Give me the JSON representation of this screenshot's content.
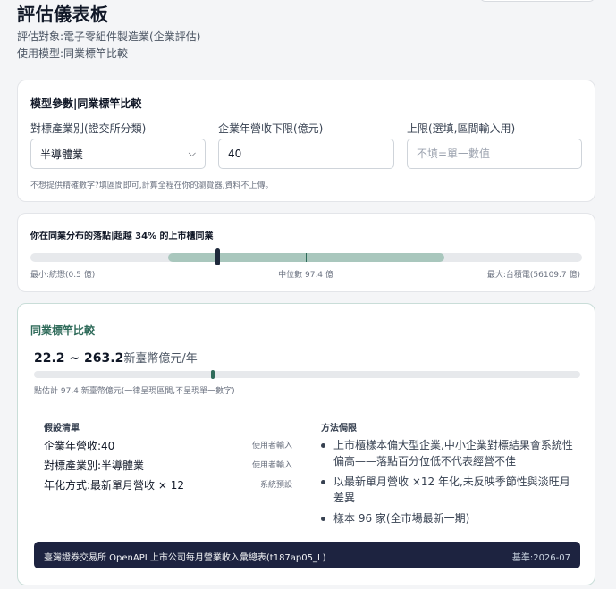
{
  "page": {
    "title": "評估儀表板",
    "target": "評估對象:電子零組件製造業(企業評估)",
    "model": "使用模型:同業標竿比較"
  },
  "params": {
    "title": "模型參數|同業標竿比較",
    "industry_label": "對標產業別(證交所分類)",
    "industry_value": "半導體業",
    "lower_label": "企業年營收下限(億元)",
    "lower_value": "40",
    "upper_label": "上限(選填,區間輸入用)",
    "upper_placeholder": "不填=單一數值",
    "note": "不想提供精確數字?填區間即可,計算全程在你的瀏覽器,資料不上傳。"
  },
  "distribution": {
    "title": "你在同業分布的落點|超越 34% 的上市櫃同業",
    "min_label": "最小:統懋(0.5 億)",
    "median_label": "中位數 97.4 億",
    "max_label": "最大:台積電(56109.7 億)",
    "percentile": 34
  },
  "benchmark": {
    "title": "同業標竿比較",
    "range": "22.2 ~ 263.2",
    "unit": "新臺幣億元/年",
    "note": "點估計 97.4 新臺幣億元(一律呈現區間,不呈現單一數字)",
    "assumptions_title": "假設清單",
    "assumptions": [
      {
        "label": "企業年營收:40",
        "source": "使用者輸入"
      },
      {
        "label": "對標產業別:半導體業",
        "source": "使用者輸入"
      },
      {
        "label": "年化方式:最新單月營收 × 12",
        "source": "系統預設"
      }
    ],
    "limits_title": "方法侷限",
    "limits": [
      "上市櫃樣本偏大型企業,中小企業對標結果會系統性偏高——落點百分位低不代表經營不佳",
      "以最新單月營收 ×12 年化,未反映季節性與淡旺月差異",
      "樣本 96 家(全市場最新一期)"
    ],
    "source": "臺灣證券交易所 OpenAPI 上市公司每月營業收入彙總表(t187ap05_L)",
    "date": "基準:2026-07"
  },
  "colors": {
    "accent": "#2f6b5a",
    "range_fill": "#a9c7bd",
    "footer_bg": "#1d2340"
  }
}
